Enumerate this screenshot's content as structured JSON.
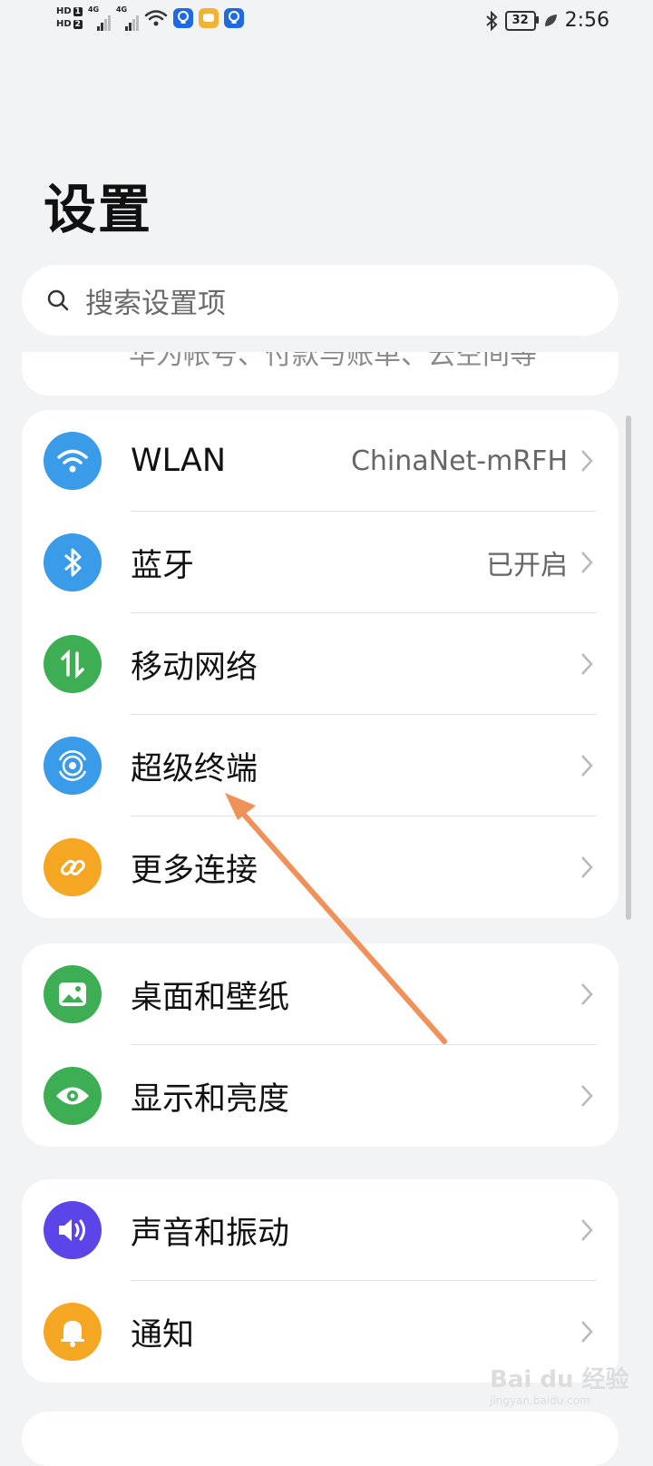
{
  "status_bar": {
    "sim1": "1",
    "sim2": "2",
    "hd": "HD",
    "net1": "4G",
    "net2": "4G",
    "battery": "32",
    "time": "2:56",
    "icons": [
      "signal-icon",
      "wifi-icon",
      "bulb-app-icon",
      "chat-app-icon",
      "bulb-app-icon",
      "bluetooth-icon",
      "battery-icon",
      "leaf-icon"
    ]
  },
  "page": {
    "title": "设置"
  },
  "search": {
    "placeholder": "搜索设置项"
  },
  "account_peek": {
    "text": "华为帐号、付款与账单、云空间等"
  },
  "groups": [
    {
      "items": [
        {
          "label": "WLAN",
          "value": "ChinaNet-mRFH",
          "icon": "wifi-icon",
          "color": "#3a9be8"
        },
        {
          "label": "蓝牙",
          "value": "已开启",
          "icon": "bluetooth-icon",
          "color": "#3a9be8"
        },
        {
          "label": "移动网络",
          "value": "",
          "icon": "mobile-data-icon",
          "color": "#3dae53"
        },
        {
          "label": "超级终端",
          "value": "",
          "icon": "super-device-icon",
          "color": "#3a9be8"
        },
        {
          "label": "更多连接",
          "value": "",
          "icon": "link-icon",
          "color": "#f5a623"
        }
      ]
    },
    {
      "items": [
        {
          "label": "桌面和壁纸",
          "value": "",
          "icon": "wallpaper-icon",
          "color": "#3dae53"
        },
        {
          "label": "显示和亮度",
          "value": "",
          "icon": "eye-icon",
          "color": "#3dae53"
        }
      ]
    },
    {
      "items": [
        {
          "label": "声音和振动",
          "value": "",
          "icon": "speaker-icon",
          "color": "#5b45e8"
        },
        {
          "label": "通知",
          "value": "",
          "icon": "bell-icon",
          "color": "#f5a623"
        }
      ]
    }
  ],
  "watermark": {
    "text": "Bai du 经验",
    "sub": "jingyan.baidu.com"
  }
}
